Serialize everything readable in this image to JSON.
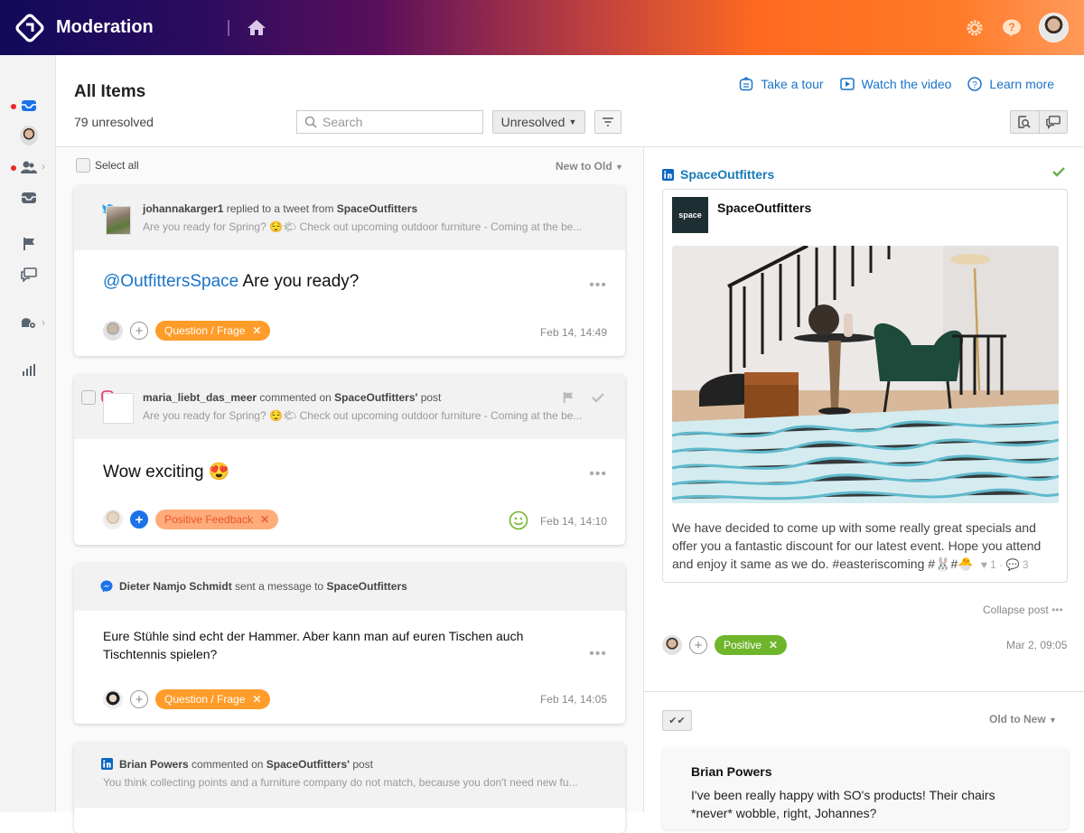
{
  "app": {
    "title": "Moderation"
  },
  "colors": {
    "accent": "#1a73c8",
    "orange_tag": "#ff9c2a",
    "peach_tag": "#ffac7a",
    "green_tag": "#6fb52c",
    "notify_dot": "#e8262b"
  },
  "sidebar": {
    "items": [
      {
        "icon": "inbox-icon",
        "active": true,
        "dot": true
      },
      {
        "icon": "user-avatar"
      },
      {
        "icon": "team-icon",
        "dot": true,
        "chevron": true
      },
      {
        "icon": "inbox-icon"
      },
      {
        "icon": "flag-icon"
      },
      {
        "icon": "chat-icon"
      },
      {
        "icon": "agent-settings-icon",
        "chevron": true
      },
      {
        "icon": "analytics-icon"
      }
    ]
  },
  "header": {
    "title": "All Items",
    "unresolved_count": "79 unresolved",
    "links": [
      {
        "label": "Take a tour",
        "icon": "tour-icon"
      },
      {
        "label": "Watch the video",
        "icon": "video-icon"
      },
      {
        "label": "Learn more",
        "icon": "help-circle-icon"
      }
    ],
    "search_placeholder": "Search",
    "status_filter": "Unresolved"
  },
  "list": {
    "select_all": "Select all",
    "sort": "New to Old",
    "items": [
      {
        "network": "twitter",
        "author": "johannakarger1",
        "action": "replied to a tweet from",
        "target": "SpaceOutfitters",
        "target_suffix": "",
        "snippet": "Are you ready for Spring? 😌🌤 Check out upcoming outdoor furniture - Coming at the be...",
        "mention": "@OutfittersSpace",
        "message": " Are you ready?",
        "tag": "Question / Frage",
        "date": "Feb 14, 14:49"
      },
      {
        "network": "instagram",
        "author": "maria_liebt_das_meer",
        "action": "commented on",
        "target": "SpaceOutfitters'",
        "target_suffix": " post",
        "snippet": "Are you ready for Spring? 😌🌤 Check out upcoming outdoor furniture - Coming at the be...",
        "message": "Wow exciting 😍",
        "tag": "Positive Feedback",
        "sentiment": "positive",
        "date": "Feb 14, 14:10"
      },
      {
        "network": "messenger",
        "author": "Dieter Namjo Schmidt",
        "action": "sent a message to",
        "target": "SpaceOutfitters",
        "target_suffix": "",
        "message": "Eure Stühle sind echt der Hammer. Aber kann man auf euren Tischen auch Tischtennis spielen?",
        "tag": "Question / Frage",
        "date": "Feb 14, 14:05"
      },
      {
        "network": "linkedin",
        "author": "Brian Powers",
        "action": "commented on",
        "target": "SpaceOutfitters'",
        "target_suffix": " post",
        "snippet": "You think collecting points and a furniture company do not match, because you don't need new fu..."
      }
    ]
  },
  "detail": {
    "account": "SpaceOutfitters",
    "post": {
      "author": "SpaceOutfitters",
      "logo_text": "space",
      "text": "We have decided to come up with some really great specials and offer you a fantastic discount for our latest event. Hope you attend and enjoy it same as we do. #easteriscoming #🐰#🐣",
      "likes": "1",
      "comments": "3"
    },
    "collapse_label": "Collapse post",
    "tag": "Positive",
    "date": "Mar 2, 09:05",
    "sort": "Old to New",
    "reply": {
      "author": "Brian Powers",
      "text": "I've been really happy with SO's products! Their chairs *never* wobble, right, Johannes?"
    }
  }
}
